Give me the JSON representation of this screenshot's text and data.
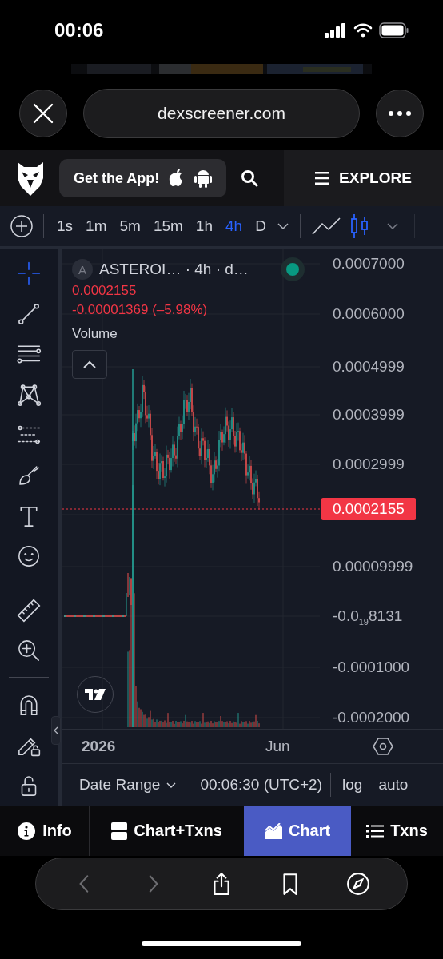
{
  "status_bar": {
    "time": "00:06"
  },
  "browser": {
    "url": "dexscreener.com"
  },
  "site_header": {
    "get_app": "Get the App!",
    "explore": "EXPLORE"
  },
  "toolbar": {
    "intervals": [
      {
        "label": "1s",
        "selected": false
      },
      {
        "label": "1m",
        "selected": false
      },
      {
        "label": "5m",
        "selected": false
      },
      {
        "label": "15m",
        "selected": false
      },
      {
        "label": "1h",
        "selected": false
      },
      {
        "label": "4h",
        "selected": true
      },
      {
        "label": "D",
        "selected": false
      }
    ],
    "chart_types": [
      {
        "kind": "line",
        "selected": false
      },
      {
        "kind": "candles",
        "selected": true
      }
    ]
  },
  "drawing_tools": [
    [
      {
        "kind": "crosshair",
        "selected": true
      },
      {
        "kind": "trend-line",
        "selected": false
      },
      {
        "kind": "fib",
        "selected": false
      },
      {
        "kind": "pattern",
        "selected": false
      },
      {
        "kind": "projection",
        "selected": false
      },
      {
        "kind": "brush",
        "selected": false
      },
      {
        "kind": "text",
        "selected": false
      },
      {
        "kind": "emoji",
        "selected": false
      }
    ],
    [
      {
        "kind": "ruler",
        "selected": false
      },
      {
        "kind": "zoom",
        "selected": false
      }
    ],
    [
      {
        "kind": "magnet",
        "selected": false
      },
      {
        "kind": "pencil-lock",
        "selected": false
      },
      {
        "kind": "lock",
        "selected": false
      }
    ]
  ],
  "legend": {
    "badge": "A",
    "title": "ASTEROI… · 4h · d…",
    "live": true,
    "price": "0.0002155",
    "change": "-0.00001369 (–5.98%)",
    "volume": "Volume"
  },
  "price_axis": [
    "0.0007000",
    "0.0006000",
    "0.0004999",
    "0.0003999",
    "0.0002999",
    "0.00009999",
    "-0.0$_{19}$8131",
    "-0.0001000",
    "-0.0002000"
  ],
  "last_price": "0.0002155",
  "time_axis": [
    {
      "label": "2026",
      "kind": "year"
    },
    {
      "label": "Jun",
      "kind": "month"
    }
  ],
  "footer": {
    "date_range": "Date Range",
    "clock": "00:06:30 (UTC+2)",
    "log": "log",
    "auto": "auto"
  },
  "bottom_tabs": [
    {
      "label": "Info",
      "kind": "info",
      "selected": false
    },
    {
      "label": "Chart+Txns",
      "kind": "split",
      "selected": false
    },
    {
      "label": "Chart",
      "kind": "chart",
      "selected": true
    },
    {
      "label": "Txns",
      "kind": "list",
      "selected": false
    }
  ],
  "safari_toolbar": [
    {
      "kind": "back",
      "disabled": true
    },
    {
      "kind": "forward",
      "disabled": true
    },
    {
      "kind": "share",
      "disabled": false
    },
    {
      "kind": "bookmarks",
      "disabled": false
    },
    {
      "kind": "compass",
      "disabled": false
    }
  ]
}
